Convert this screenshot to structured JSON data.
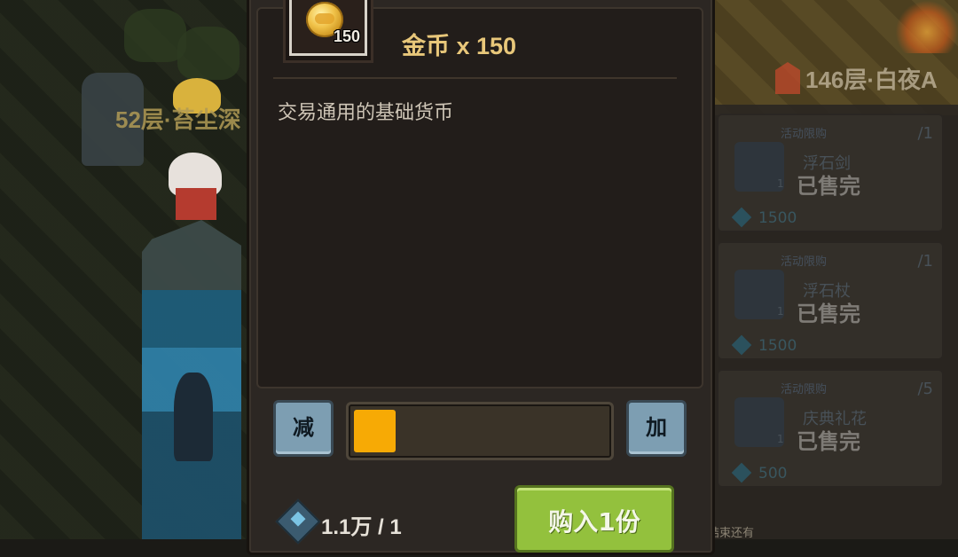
{
  "scene": {
    "floor_left": "52层·苔尘深",
    "floor_right": "146层·白夜A",
    "footer_note": "结束还有"
  },
  "shop_cards": [
    {
      "category": "活动限购",
      "limit": "/1",
      "name": "浮石剑",
      "count": "1",
      "status": "已售完",
      "price": "1500"
    },
    {
      "category": "活动限购",
      "limit": "/1",
      "name": "浮石杖",
      "count": "1",
      "status": "已售完",
      "price": "1500"
    },
    {
      "category": "活动限购",
      "limit": "/5",
      "name": "庆典礼花",
      "count": "1",
      "status": "已售完",
      "price": "500"
    }
  ],
  "item": {
    "icon": "gold-coin-icon",
    "count": "150",
    "title": "金币 x 150",
    "description": "交易通用的基础货币"
  },
  "quantity": {
    "decrease_label": "减",
    "increase_label": "加",
    "slider_fraction": 0.17
  },
  "cost": {
    "icon": "diamond-gem-icon",
    "text": "1.1万 / 1"
  },
  "buy_button": {
    "label": "购入1份"
  },
  "colors": {
    "title_gold": "#e8c77a",
    "slider_fill": "#f7aa05",
    "buy_green": "#93c13d",
    "step_blue": "#7d9eb2"
  }
}
